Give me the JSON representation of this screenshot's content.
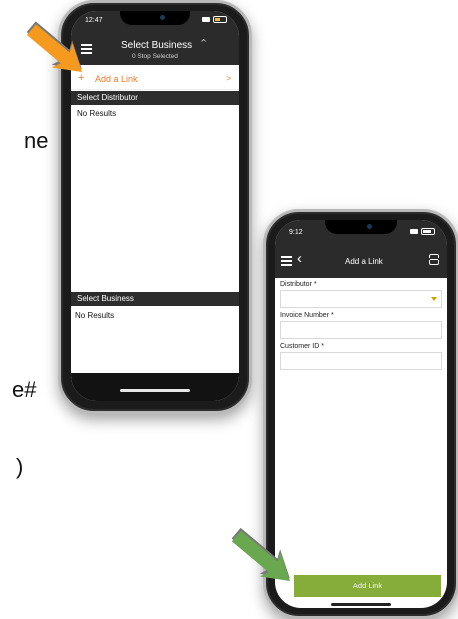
{
  "edge_text": [
    "ne",
    "e#",
    ")"
  ],
  "phone1": {
    "status_time": "12:47",
    "header_title": "Select Business",
    "header_subtitle": "0 Stop Selected",
    "add_link_label": "Add a Link",
    "add_link_plus": "+",
    "chevron": ">",
    "section_distributor": "Select Distributor",
    "distributor_results": "No Results",
    "section_business": "Select Business",
    "business_results": "No Results"
  },
  "phone2": {
    "status_time": "9:12",
    "header_title": "Add a Link",
    "fields": [
      {
        "label": "Distributor *",
        "value": "",
        "type": "select"
      },
      {
        "label": "Invoice Number *",
        "value": "",
        "type": "text"
      },
      {
        "label": "Customer ID *",
        "value": "",
        "type": "text"
      }
    ],
    "submit_label": "Add Link"
  },
  "colors": {
    "accent_orange": "#f07a2a",
    "arrow_orange": "#f59a1e",
    "arrow_green": "#6aa84f",
    "button_green": "#86ad3a",
    "header_dark": "#2b2b2b"
  }
}
